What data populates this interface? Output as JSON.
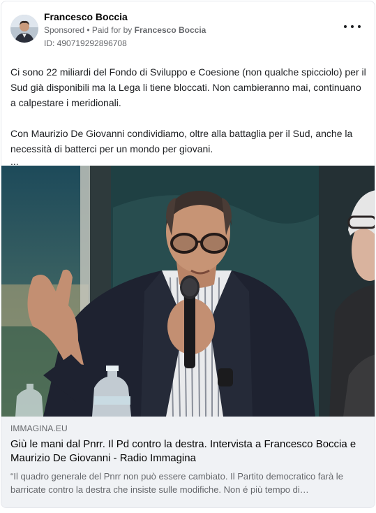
{
  "post": {
    "author": "Francesco Boccia",
    "sponsored_label": "Sponsored",
    "separator": " • ",
    "paid_for_prefix": "Paid for by ",
    "paid_for_name": "Francesco Boccia",
    "ad_id": "ID: 490719292896708",
    "more_icon": "more-horizontal-icon",
    "paragraphs": [
      "Ci sono 22 miliardi del Fondo di Sviluppo e Coesione (non qualche spicciolo) per il Sud già disponibili ma la Lega li tiene bloccati. Non cambieranno mai, continuano a calpestare i meridionali.",
      "Con Maurizio De Giovanni condividiamo, oltre alla battaglia per il Sud, anche la necessità di batterci per un mondo per giovani."
    ],
    "ellipsis": "..."
  },
  "link": {
    "domain": "IMMAGINA.EU",
    "title": "Giù le mani dal Pnrr. Il Pd contro la destra. Intervista a Francesco Boccia e Maurizio De Giovanni - Radio Immagina",
    "description": "“Il quadro generale del Pnrr non può essere cambiato. Il Partito democratico farà le barricate contro la destra che insiste sulle modifiche. Non é più tempo di…"
  }
}
